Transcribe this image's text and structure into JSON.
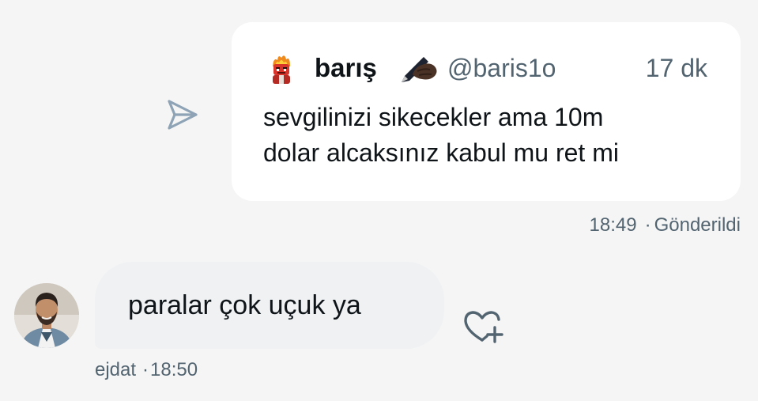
{
  "quoted_post": {
    "display_name": "barış",
    "handle": "@baris1o",
    "time_ago": "17 dk",
    "text_lines": [
      "sevgilinizi sikecekler ama 10m",
      "dolar alcaksınız kabul mu ret mi"
    ],
    "avatar_icon": "angry-character-avatar",
    "emoji_icon": "writing-hand-emoji"
  },
  "sent_message": {
    "time": "18:49",
    "separator": "·",
    "status": "Gönderildi",
    "share_icon": "send-arrow-icon"
  },
  "received_message": {
    "text": "paralar çok uçuk ya",
    "sender": "ejdat",
    "separator": "·",
    "time": "18:50",
    "reaction_icon": "heart-plus-icon"
  },
  "colors": {
    "background": "#f5f5f5",
    "card": "#ffffff",
    "bubble": "#eff1f3",
    "primary_text": "#0f1419",
    "secondary_text": "#536471"
  }
}
